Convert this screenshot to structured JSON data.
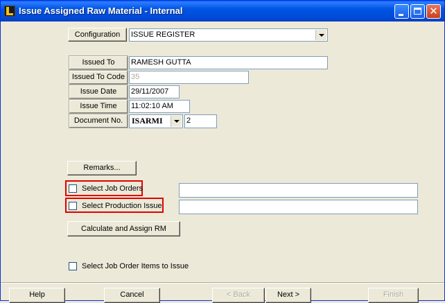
{
  "window": {
    "title": "Issue Assigned Raw Material - Internal"
  },
  "config": {
    "button_label": "Configuration",
    "value": "ISSUE REGISTER"
  },
  "form": {
    "issued_to": {
      "label": "Issued To",
      "value": "RAMESH GUTTA"
    },
    "issued_to_code": {
      "label": "Issued To Code",
      "value": "35"
    },
    "issue_date": {
      "label": "Issue Date",
      "value": "29/11/2007"
    },
    "issue_time": {
      "label": "Issue Time",
      "value": "11:02:10 AM"
    },
    "document_no": {
      "label": "Document No.",
      "series": "ISARMI",
      "number": "2"
    }
  },
  "remarks_button": "Remarks...",
  "select_job_orders": {
    "label": "Select Job Orders",
    "checked": false,
    "value": ""
  },
  "select_production_issue": {
    "label": "Select Production Issue",
    "checked": false,
    "value": ""
  },
  "calculate_button": "Calculate and Assign RM",
  "select_job_order_items": {
    "label": "Select Job Order Items to Issue",
    "checked": false
  },
  "footer": {
    "help": "Help",
    "cancel": "Cancel",
    "back": "< Back",
    "next": "Next >",
    "finish": "Finish"
  },
  "colors": {
    "titlebar": "#0054e3",
    "highlight_frame": "#e00000",
    "dialog_bg": "#ece9d8"
  }
}
